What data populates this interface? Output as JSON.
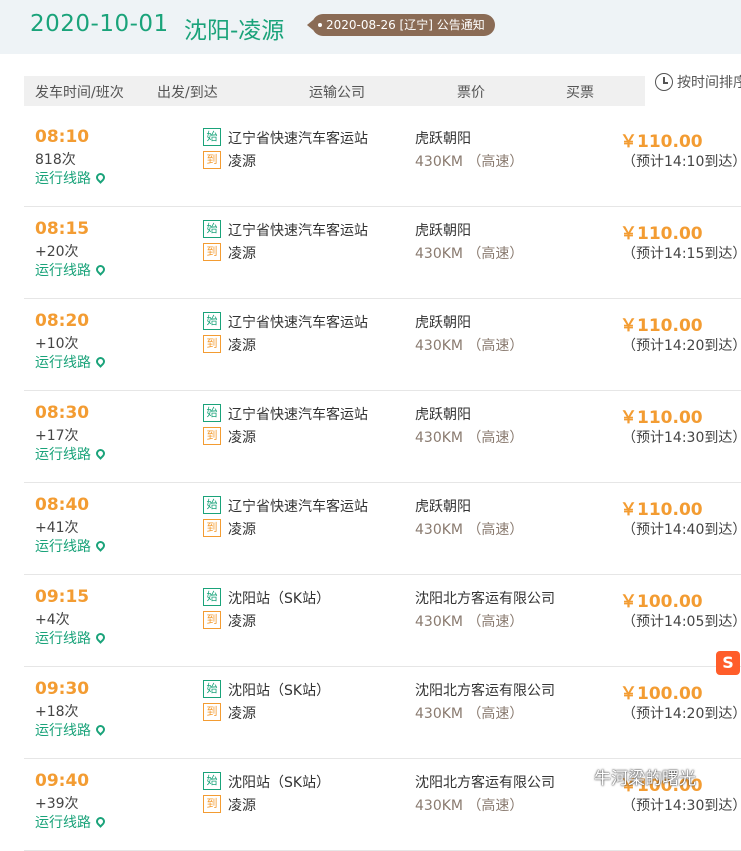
{
  "top": {
    "date": "2020-10-01",
    "route": "沈阳-凌源",
    "notice": "2020-08-26 [辽宁] 公告通知"
  },
  "header": {
    "time": "发车时间/班次",
    "dep_arr": "出发/到达",
    "company": "运输公司",
    "price": "票价",
    "buy": "买票",
    "sort": "按时间排序"
  },
  "tags": {
    "start": "始",
    "end": "到"
  },
  "link_label": "运行线路",
  "rows": [
    {
      "time": "08:10",
      "trip": "818次",
      "station": "辽宁省快速汽车客运站",
      "dest": "凌源",
      "company": "虎跃朝阳",
      "distance": "430KM （高速）",
      "price": "￥110.00",
      "arrive": "（预计14:10到达）"
    },
    {
      "time": "08:15",
      "trip": "+20次",
      "station": "辽宁省快速汽车客运站",
      "dest": "凌源",
      "company": "虎跃朝阳",
      "distance": "430KM （高速）",
      "price": "￥110.00",
      "arrive": "（预计14:15到达）"
    },
    {
      "time": "08:20",
      "trip": "+10次",
      "station": "辽宁省快速汽车客运站",
      "dest": "凌源",
      "company": "虎跃朝阳",
      "distance": "430KM （高速）",
      "price": "￥110.00",
      "arrive": "（预计14:20到达）"
    },
    {
      "time": "08:30",
      "trip": "+17次",
      "station": "辽宁省快速汽车客运站",
      "dest": "凌源",
      "company": "虎跃朝阳",
      "distance": "430KM （高速）",
      "price": "￥110.00",
      "arrive": "（预计14:30到达）"
    },
    {
      "time": "08:40",
      "trip": "+41次",
      "station": "辽宁省快速汽车客运站",
      "dest": "凌源",
      "company": "虎跃朝阳",
      "distance": "430KM （高速）",
      "price": "￥110.00",
      "arrive": "（预计14:40到达）"
    },
    {
      "time": "09:15",
      "trip": "+4次",
      "station": "沈阳站（SK站）",
      "dest": "凌源",
      "company": "沈阳北方客运有限公司",
      "distance": "430KM （高速）",
      "price": "￥100.00",
      "arrive": "（预计14:05到达）"
    },
    {
      "time": "09:30",
      "trip": "+18次",
      "station": "沈阳站（SK站）",
      "dest": "凌源",
      "company": "沈阳北方客运有限公司",
      "distance": "430KM （高速）",
      "price": "￥100.00",
      "arrive": "（预计14:20到达）"
    },
    {
      "time": "09:40",
      "trip": "+39次",
      "station": "沈阳站（SK站）",
      "dest": "凌源",
      "company": "沈阳北方客运有限公司",
      "distance": "430KM （高速）",
      "price": "￥100.00",
      "arrive": "（预计14:30到达）"
    }
  ],
  "badge": {
    "sogou": "S"
  },
  "watermark": "牛河梁的曙光",
  "colors": {
    "accent": "#1aa37a",
    "price": "#f39c32",
    "notice_bg": "#8a6b55"
  }
}
